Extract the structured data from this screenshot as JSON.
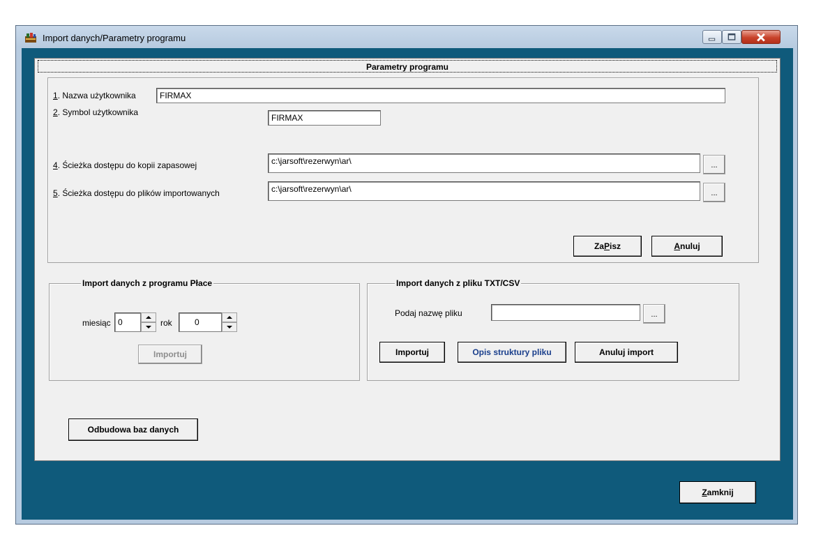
{
  "window": {
    "title": "Import danych/Parametry programu"
  },
  "params": {
    "header": "Parametry programu",
    "f1_num": "1",
    "f1_label": ". Nazwa użytkownika",
    "f1_value": "FIRMAX",
    "f2_num": "2",
    "f2_label": ". Symbol użytkownika",
    "f2_value": "FIRMAX",
    "f4_num": "4",
    "f4_label": ". Ścieżka  dostępu do kopii zapasowej",
    "f4_value": "c:\\jarsoft\\rezerwyn\\ar\\",
    "f5_num": "5",
    "f5_label": ". Ścieżka  dostępu do plików importowanych",
    "f5_value": "c:\\jarsoft\\rezerwyn\\ar\\",
    "browse": "...",
    "save_pre": "Za",
    "save_u": "P",
    "save_post": "isz",
    "cancel_u": "A",
    "cancel_post": "nuluj"
  },
  "place": {
    "title": "Import danych z  programu Płace",
    "month_label": "miesiąc",
    "month_value": "0",
    "year_label": "rok",
    "year_value": "0",
    "import": "Importuj"
  },
  "txt": {
    "title": "Import danych z  pliku TXT/CSV",
    "file_label": "Podaj nazwę pliku",
    "file_value": "",
    "browse": "...",
    "import": "Importuj",
    "desc": "Opis struktury pliku",
    "cancel": "Anuluj import"
  },
  "rebuild": "Odbudowa baz danych",
  "close_u": "Z",
  "close_post": "amknij"
}
